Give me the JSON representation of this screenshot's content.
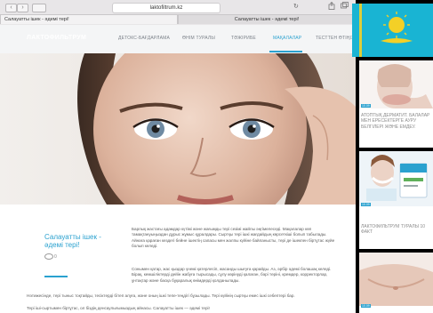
{
  "browser": {
    "url": "laktofiltrum.kz",
    "tabs": [
      {
        "label": "Салауатты ішек - әдемі тері!"
      },
      {
        "label": "Салауатты ішек - әдемі тері!"
      }
    ],
    "back_glyph": "‹",
    "forward_glyph": "›",
    "reload_glyph": "↻"
  },
  "site": {
    "logo": "ЛАКТОФИЛЬТРУМ",
    "nav": [
      {
        "label": "ДЕТОКС-БАҒДАРЛАМА",
        "active": false
      },
      {
        "label": "ӨНІМ ТУРАЛЫ",
        "active": false
      },
      {
        "label": "ТӘЖІРИБЕ",
        "active": false
      },
      {
        "label": "МАҚАЛАЛАР",
        "active": true
      },
      {
        "label": "ТЕСТТЕН ӨТІҢІЗ",
        "active": false
      }
    ]
  },
  "article": {
    "title": "Салауатты ішек - әдемі тері!",
    "views": "0",
    "paragraphs": [
      "Барлық жастағы адамдар күтімі және жағымды тері сезімі жайлы әңгімелеседі. Мақалалар көп тамақтануыңыздан дұрыс жұмыс құралдары. Сыртқы тері ішкі жағдайдың көрсеткіші болып табылады. Айнаға қараған кездегі бейне ішектің сапасы мен жалпы күйіне байланысты, тері де ішекпен біртұтас жүйе болып келеді.",
      "Сонымен қатар, жас қыздар үнемі қатерлесіп, жасанды шығуға қарайды. Аз, әрбір әдемі болашақ келеді. Бірақ, кемшіліктерді дейін жабуға тырысады, сұлу көрінуді қалаған, бәрі теріні, кремдер, корректорлар, ұнтақтар және басқа бұқаралық өнімдерді қолданылады.",
      "Нәтижесінде, тері тыныс тоқтайды, тесіктерді бітеп алуға, және оның ішкі тепе-теңдігі бұзылады. Тері күйінің сыртқы емес ішкі себептері бар.",
      "Тері іші-сыртымен біртұтас, ол біздің денсаулығымыздың айнасы. Салауатты ішек — әдемі тері!"
    ]
  },
  "sidebar": {
    "cards": [
      {
        "text": "АТОПТЫҚ ДЕРМАТИТ. БАЛАЛАР МЕН ЕРЕСЕКТЕРГЕ АУРУ БЕЛГІЛЕРІ ЖӘНЕ ЕМДЕУ.",
        "badge": "10.09"
      },
      {
        "text": "ЛАКТОФИЛЬТРУМ ТУРАЛЫ 10 ФАКТ",
        "badge": "10.09"
      },
      {
        "text": "",
        "badge": "10.09"
      }
    ]
  },
  "colors": {
    "accent": "#2aa1cf",
    "flag": "#19b4d3",
    "sun": "#f3d027"
  }
}
